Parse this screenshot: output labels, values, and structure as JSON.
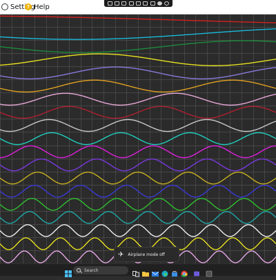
{
  "menu": {
    "setting_label": "Setting",
    "help_label": "Help",
    "setting_icon": "gear-circle-icon",
    "help_icon": "help-circle-icon"
  },
  "floating_toolbar": {
    "icons": [
      "document-icon",
      "copy-icon",
      "camera-icon",
      "layout-icon",
      "cut-icon",
      "pen-icon",
      "image-icon",
      "record-icon",
      "settings-icon"
    ]
  },
  "plot": {
    "background": "#2b2b2b",
    "grid_color": "#505050",
    "waves": [
      {
        "color": "#d42020",
        "cycles": 0.28,
        "amplitude": 0.35,
        "phase": -1.2
      },
      {
        "color": "#1ab8d8",
        "cycles": 0.55,
        "amplitude": 0.45,
        "phase": 0.6
      },
      {
        "color": "#1e8a3c",
        "cycles": 0.85,
        "amplitude": 0.45,
        "phase": 0.0
      },
      {
        "color": "#e8e020",
        "cycles": 1.2,
        "amplitude": 0.45,
        "phase": 2.0
      },
      {
        "color": "#8a7adc",
        "cycles": 1.6,
        "amplitude": 0.45,
        "phase": 0.5
      },
      {
        "color": "#e0a020",
        "cycles": 2.0,
        "amplitude": 0.45,
        "phase": 0.4
      },
      {
        "color": "#e8a8d8",
        "cycles": 2.5,
        "amplitude": 0.45,
        "phase": 1.0
      },
      {
        "color": "#b02030",
        "cycles": 3.0,
        "amplitude": 0.45,
        "phase": 0.0
      },
      {
        "color": "#c8c8c8",
        "cycles": 3.5,
        "amplitude": 0.45,
        "phase": 0.8
      },
      {
        "color": "#20d0c0",
        "cycles": 4.0,
        "amplitude": 0.45,
        "phase": 0.0
      },
      {
        "color": "#e020e0",
        "cycles": 4.5,
        "amplitude": 0.45,
        "phase": 1.57
      },
      {
        "color": "#7a3ae0",
        "cycles": 5.0,
        "amplitude": 0.45,
        "phase": 0.0
      },
      {
        "color": "#c8b020",
        "cycles": 5.5,
        "amplitude": 0.45,
        "phase": 0.0
      },
      {
        "color": "#3a3ad8",
        "cycles": 6.0,
        "amplitude": 0.45,
        "phase": 0.0
      },
      {
        "color": "#30c030",
        "cycles": 6.5,
        "amplitude": 0.45,
        "phase": 0.0
      },
      {
        "color": "#20a8a8",
        "cycles": 7.0,
        "amplitude": 0.45,
        "phase": 0.0
      },
      {
        "color": "#f0f0f0",
        "cycles": 7.5,
        "amplitude": 0.45,
        "phase": 0.0
      },
      {
        "color": "#e8e020",
        "cycles": 8.0,
        "amplitude": 0.45,
        "phase": 0.0
      },
      {
        "color": "#e8a8e8",
        "cycles": 8.5,
        "amplitude": 0.45,
        "phase": 0.0
      }
    ]
  },
  "toast": {
    "icon": "airplane-icon",
    "text": "Airplane mode off"
  },
  "taskbar": {
    "search_placeholder": "Search",
    "start_icon": "windows-start-icon",
    "icons": [
      "task-view-icon",
      "file-explorer-icon",
      "mail-icon",
      "edge-browser-icon",
      "store-icon",
      "chrome-icon",
      "teams-icon",
      "app-icon"
    ]
  }
}
